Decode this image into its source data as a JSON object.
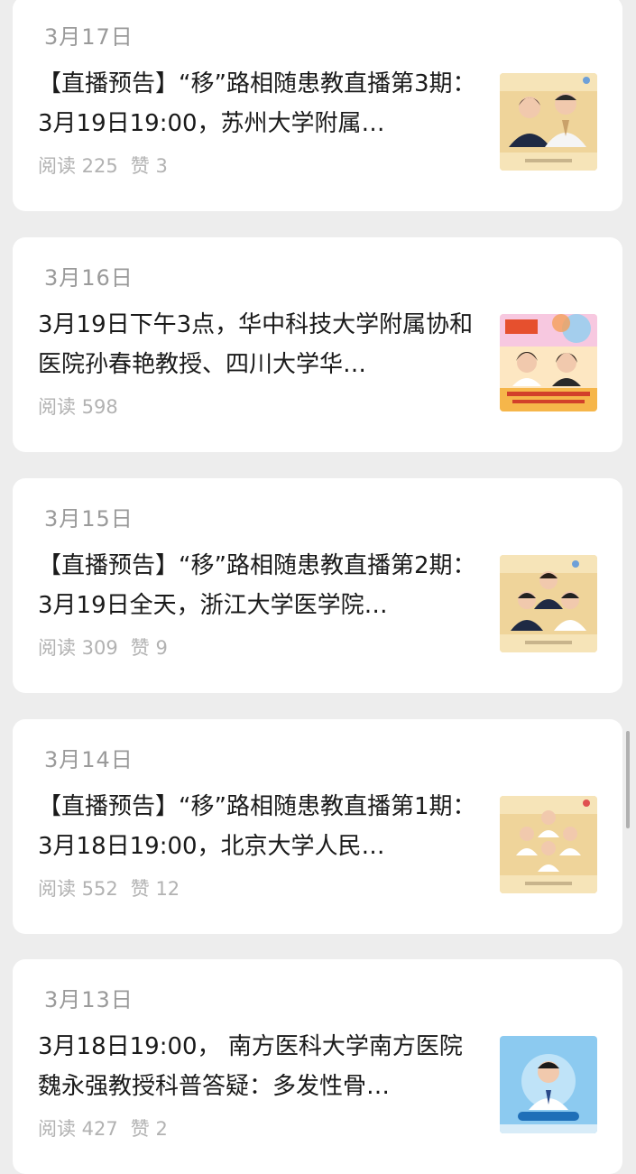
{
  "articles": [
    {
      "date": "3月17日",
      "title": "【直播预告】“移”路相随患教直播第3期：3月19日19:00，苏州大学附属…",
      "reads": "阅读 225",
      "likes": "赞 3",
      "thumb_icon": "two-doctors-portrait-thumbnail"
    },
    {
      "date": "3月16日",
      "title": "3月19日下午3点，华中科技大学附属协和医院孙春艳教授、四川大学华…",
      "reads": "阅读 598",
      "likes": "",
      "thumb_icon": "colorful-event-poster-thumbnail"
    },
    {
      "date": "3月15日",
      "title": "【直播预告】“移”路相随患教直播第2期：3月19日全天，浙江大学医学院…",
      "reads": "阅读 309",
      "likes": "赞 9",
      "thumb_icon": "three-doctors-portrait-thumbnail"
    },
    {
      "date": "3月14日",
      "title": "【直播预告】“移”路相随患教直播第1期：3月18日19:00，北京大学人民…",
      "reads": "阅读 552",
      "likes": "赞 12",
      "thumb_icon": "group-doctors-portrait-thumbnail"
    },
    {
      "date": "3月13日",
      "title": "3月18日19:00， 南方医科大学南方医院魏永强教授科普答疑：多发性骨…",
      "reads": "阅读 427",
      "likes": "赞 2",
      "thumb_icon": "doctor-blue-portrait-thumbnail"
    }
  ]
}
